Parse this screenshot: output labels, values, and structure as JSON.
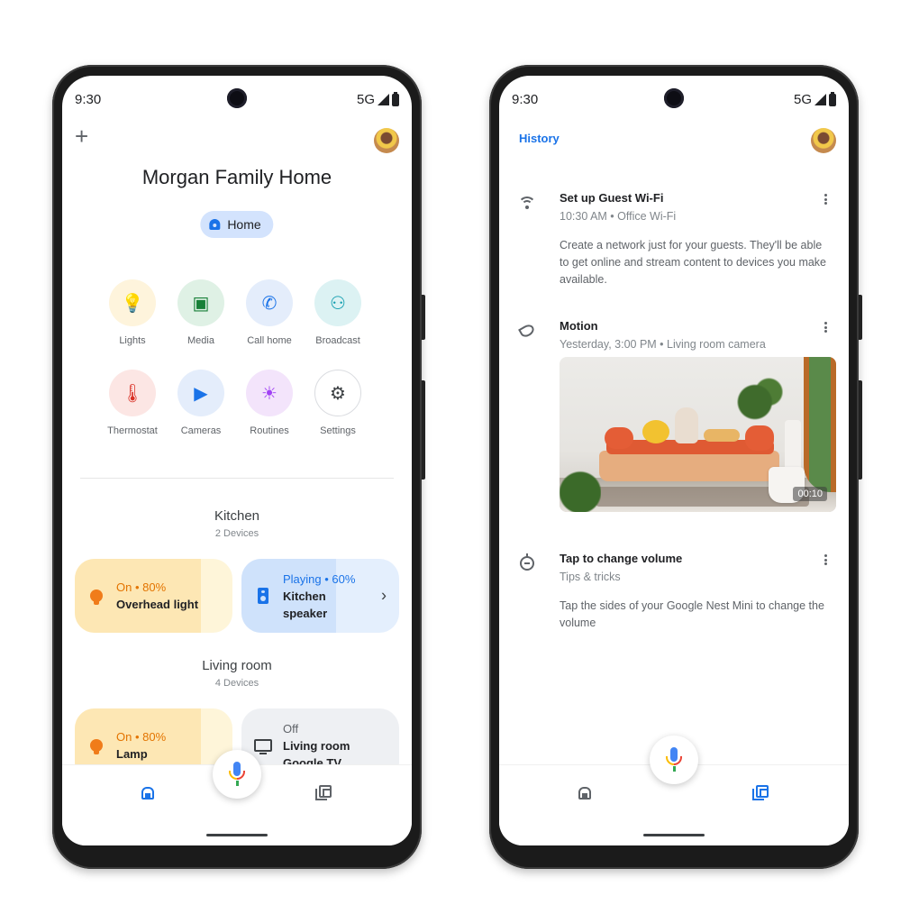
{
  "left_phone": {
    "status_bar": {
      "time": "9:30",
      "network": "5G",
      "icons": [
        "signal-icon",
        "battery-icon"
      ]
    },
    "add_icon": "+",
    "home_name": "Morgan Family Home",
    "home_chip_label": "Home",
    "actions": [
      {
        "label": "Lights",
        "icon": "lightbulb-icon",
        "glyph": "💡",
        "bg": "#fef4dc",
        "color": "#e8710a"
      },
      {
        "label": "Media",
        "icon": "media-icon",
        "glyph": "▣",
        "bg": "#dff1e5",
        "color": "#188038"
      },
      {
        "label": "Call home",
        "icon": "phone-icon",
        "glyph": "✆",
        "bg": "#e4edfb",
        "color": "#1a73e8"
      },
      {
        "label": "Broadcast",
        "icon": "broadcast-icon",
        "glyph": "⚇",
        "bg": "#dcf2f3",
        "color": "#129eaf"
      },
      {
        "label": "Thermostat",
        "icon": "thermostat-icon",
        "glyph": "🌡",
        "bg": "#fce6e4",
        "color": "#d93025"
      },
      {
        "label": "Cameras",
        "icon": "camera-icon",
        "glyph": "▶",
        "bg": "#e4edfb",
        "color": "#1a73e8"
      },
      {
        "label": "Routines",
        "icon": "routines-icon",
        "glyph": "☀",
        "bg": "#f3e4fb",
        "color": "#a142f4"
      },
      {
        "label": "Settings",
        "icon": "settings-icon",
        "glyph": "⚙",
        "bg": "#ffffff",
        "color": "#3c4043"
      }
    ],
    "rooms": [
      {
        "name": "Kitchen",
        "device_count": "2 Devices",
        "devices": [
          {
            "state": "On • 80%",
            "name": "Overhead light",
            "level": 80,
            "type": "light"
          },
          {
            "state": "Playing • 60%",
            "name": "Kitchen speaker",
            "level": 60,
            "type": "speaker",
            "chevron": "›"
          }
        ]
      },
      {
        "name": "Living room",
        "device_count": "4 Devices",
        "devices": [
          {
            "state": "On • 80%",
            "name": "Lamp",
            "level": 80,
            "type": "light"
          },
          {
            "state": "Off",
            "name": "Living room Google TV",
            "level": 0,
            "type": "tv"
          }
        ]
      }
    ],
    "nav": {
      "active": "home",
      "items": [
        "home",
        "feed"
      ]
    }
  },
  "right_phone": {
    "status_bar": {
      "time": "9:30",
      "network": "5G",
      "icons": [
        "signal-icon",
        "battery-icon"
      ]
    },
    "title": "History",
    "feed": [
      {
        "icon": "wifi-icon",
        "title": "Set up Guest Wi-Fi",
        "meta": "10:30 AM • Office Wi-Fi",
        "body": "Create a network just for your guests. They'll be able to get online and stream content to devices you make available."
      },
      {
        "icon": "motion-icon",
        "title": "Motion",
        "meta": "Yesterday, 3:00 PM • Living room camera",
        "clip_duration": "00:10"
      },
      {
        "icon": "nest-mini-icon",
        "title": "Tap to change volume",
        "meta": "Tips & tricks",
        "body": "Tap the sides of your Google Nest Mini to change the volume"
      }
    ],
    "nav": {
      "active": "feed",
      "items": [
        "home",
        "feed"
      ]
    }
  },
  "colors": {
    "accent_blue": "#1a73e8",
    "inactive_icon": "#5f6368"
  }
}
